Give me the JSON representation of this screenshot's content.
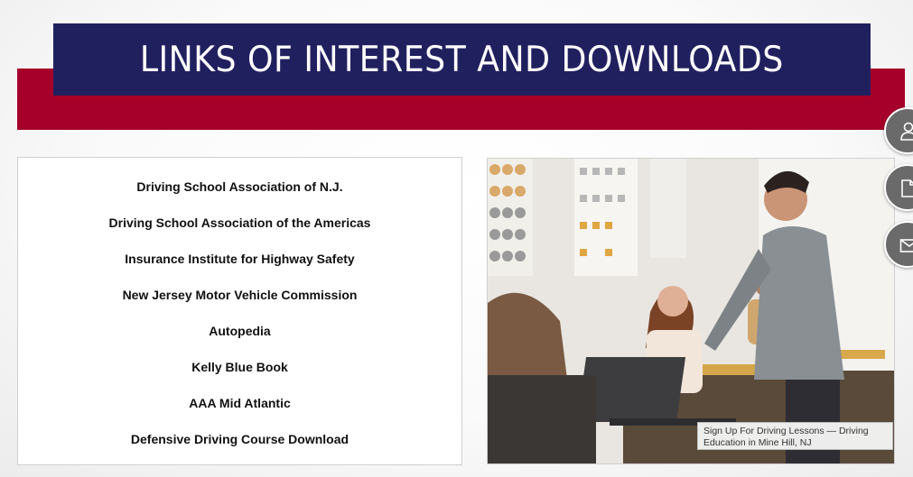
{
  "header": {
    "title": "LINKS OF INTEREST AND DOWNLOADS"
  },
  "links": [
    {
      "label": "Driving School Association of N.J."
    },
    {
      "label": "Driving School Association of the Americas"
    },
    {
      "label": "Insurance Institute for Highway Safety"
    },
    {
      "label": "New Jersey Motor Vehicle Commission"
    },
    {
      "label": "Autopedia"
    },
    {
      "label": "Kelly Blue Book"
    },
    {
      "label": "AAA Mid Atlantic"
    },
    {
      "label": "Defensive Driving Course Download"
    }
  ],
  "photo": {
    "caption": "Sign Up For Driving Lessons — Driving Education in Mine Hill, NJ"
  },
  "side_actions": [
    {
      "icon": "user-icon"
    },
    {
      "icon": "document-icon"
    },
    {
      "icon": "envelope-icon"
    }
  ],
  "colors": {
    "title_bg": "#21205f",
    "band_red": "#a6002a"
  }
}
